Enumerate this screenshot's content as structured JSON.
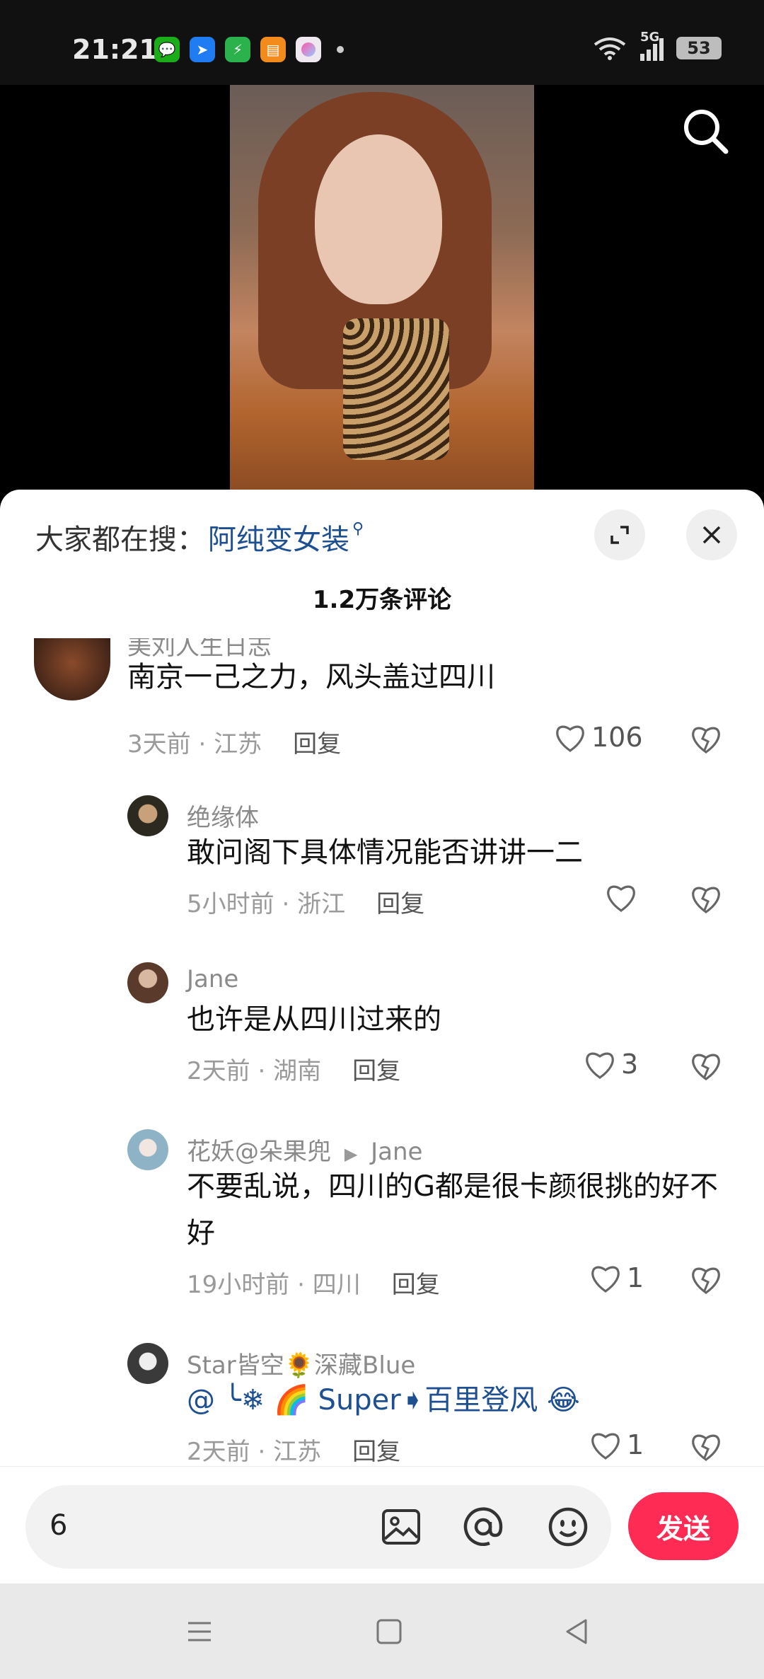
{
  "status_bar": {
    "time": "21:21",
    "app_icons": [
      "wechat-icon",
      "feishu-icon",
      "security-icon",
      "mail-icon",
      "gallery-icon"
    ],
    "network": "5G",
    "battery": "53"
  },
  "hot_search": {
    "prefix": "大家都在搜：",
    "term": "阿纯变女装"
  },
  "comment_count": "1.2万条评论",
  "comments": [
    {
      "username": "美刘人生日志",
      "text": "南京一己之力，风头盖过四川",
      "time": "3天前",
      "location": "江苏",
      "reply": "回复",
      "likes": "106"
    },
    {
      "username": "绝缘体",
      "text": "敢问阁下具体情况能否讲讲一二",
      "time": "5小时前",
      "location": "浙江",
      "reply": "回复",
      "likes": ""
    },
    {
      "username": "Jane",
      "text": "也许是从四川过来的",
      "time": "2天前",
      "location": "湖南",
      "reply": "回复",
      "likes": "3"
    },
    {
      "username": "花妖@朵果兜",
      "reply_to": "Jane",
      "text": "不要乱说，四川的G都是很卡颜很挑的好不好",
      "time": "19小时前",
      "location": "四川",
      "reply": "回复",
      "likes": "1"
    },
    {
      "username": "Star皆空🌻深藏Blue",
      "text": "@ ╰❄ 🌈 Super➧百里登风 😂",
      "time": "2天前",
      "location": "江苏",
      "reply": "回复",
      "likes": "1"
    }
  ],
  "input": {
    "value": "6",
    "send_label": "发送"
  },
  "colors": {
    "accent": "#fe2c55",
    "link": "#1d4f91"
  }
}
